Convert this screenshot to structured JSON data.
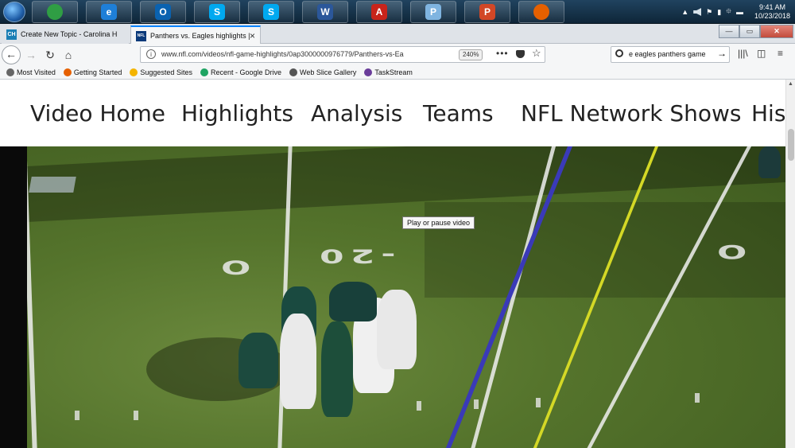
{
  "taskbar": {
    "apps": [
      {
        "name": "chrome",
        "color": "#2f9e44",
        "glyph": ""
      },
      {
        "name": "internet-explorer",
        "color": "#1e7fd8",
        "glyph": "e"
      },
      {
        "name": "outlook",
        "color": "#0a62b0",
        "glyph": "O"
      },
      {
        "name": "skype",
        "color": "#00a9f0",
        "glyph": "S"
      },
      {
        "name": "skype-business",
        "color": "#00a9f0",
        "glyph": "S"
      },
      {
        "name": "word",
        "color": "#2b579a",
        "glyph": "W"
      },
      {
        "name": "acrobat",
        "color": "#c8241b",
        "glyph": "A"
      },
      {
        "name": "paint",
        "color": "#7fb4e0",
        "glyph": "P"
      },
      {
        "name": "powerpoint",
        "color": "#d24726",
        "glyph": "P"
      },
      {
        "name": "firefox",
        "color": "#e66000",
        "glyph": ""
      }
    ],
    "clock_time": "9:41 AM",
    "clock_date": "10/23/2018"
  },
  "tabs": [
    {
      "title": "Create New Topic - Carolina H",
      "favicon": "CH",
      "favicon_color": "#1a7fb5",
      "active": false
    },
    {
      "title": "Panthers vs. Eagles highlights |",
      "favicon": "NFL",
      "favicon_color": "#0b3a7a",
      "active": true
    }
  ],
  "newtab_symbol": "+",
  "window_controls": {
    "minimize": "—",
    "maximize": "▭",
    "close": "✕"
  },
  "navbar": {
    "url": "www.nfl.com/videos/nfl-game-highlights/0ap3000000976779/Panthers-vs-Ea",
    "zoom": "240%",
    "search_text": "e eagles panthers game"
  },
  "bookmarks": [
    {
      "label": "Most Visited",
      "icon": "gear-icon",
      "color": "#666"
    },
    {
      "label": "Getting Started",
      "icon": "firefox-icon",
      "color": "#e66000"
    },
    {
      "label": "Suggested Sites",
      "icon": "bing-icon",
      "color": "#f4b400"
    },
    {
      "label": "Recent - Google Drive",
      "icon": "drive-icon",
      "color": "#1fa463"
    },
    {
      "label": "Web Slice Gallery",
      "icon": "globe-icon",
      "color": "#555"
    },
    {
      "label": "TaskStream",
      "icon": "taskstream-icon",
      "color": "#6a3d9a"
    }
  ],
  "site_nav": [
    "Video Home",
    "Highlights",
    "Analysis",
    "Teams",
    "NFL Network Shows",
    "Hist"
  ],
  "video": {
    "yard_numbers": [
      "O",
      "-20",
      "O"
    ],
    "tooltip": "Play or pause video"
  }
}
